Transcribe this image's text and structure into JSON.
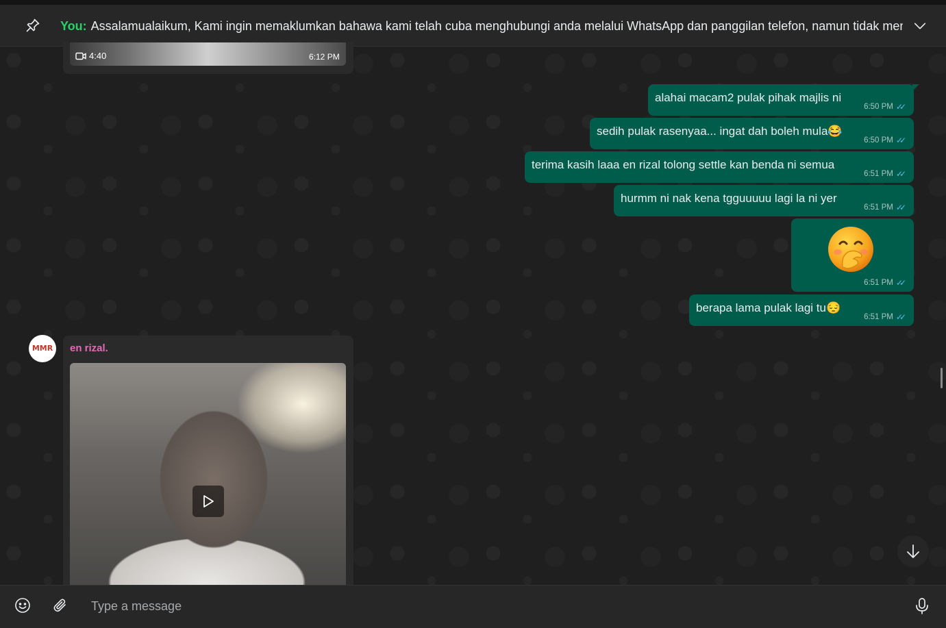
{
  "pinned": {
    "sender": "You:",
    "text": "Assalamualaikum,  Kami ingin memaklumkan bahawa kami telah cuba menghubungi anda melalui WhatsApp dan panggilan telefon, namun tidak mener..."
  },
  "top_video": {
    "duration": "4:40",
    "time": "6:12 PM"
  },
  "outgoing": [
    {
      "text": "alahai macam2 pulak pihak majlis ni",
      "time": "6:50 PM"
    },
    {
      "text": "sedih pulak rasenyaa... ingat dah boleh mula😂",
      "time": "6:50 PM"
    },
    {
      "text": "terima kasih laaa en rizal tolong  settle kan benda ni semua",
      "time": "6:51 PM"
    },
    {
      "text": "hurmm ni nak kena tgguuuuu lagi la ni yer",
      "time": "6:51 PM"
    },
    {
      "text": "",
      "time": "6:51 PM",
      "emoji_icon": "face-with-hand-over-mouth-icon"
    },
    {
      "text": "berapa lama pulak lagi tu😔",
      "time": "6:51 PM"
    }
  ],
  "incoming": {
    "sender": "en rizal.",
    "avatar_text": "MMR"
  },
  "composer": {
    "placeholder": "Type a message"
  },
  "colors": {
    "outgoing_bubble": "#005c4b",
    "sender_name": "#e26ab6",
    "you_label": "#25d366",
    "read_ticks": "#53bdeb"
  }
}
